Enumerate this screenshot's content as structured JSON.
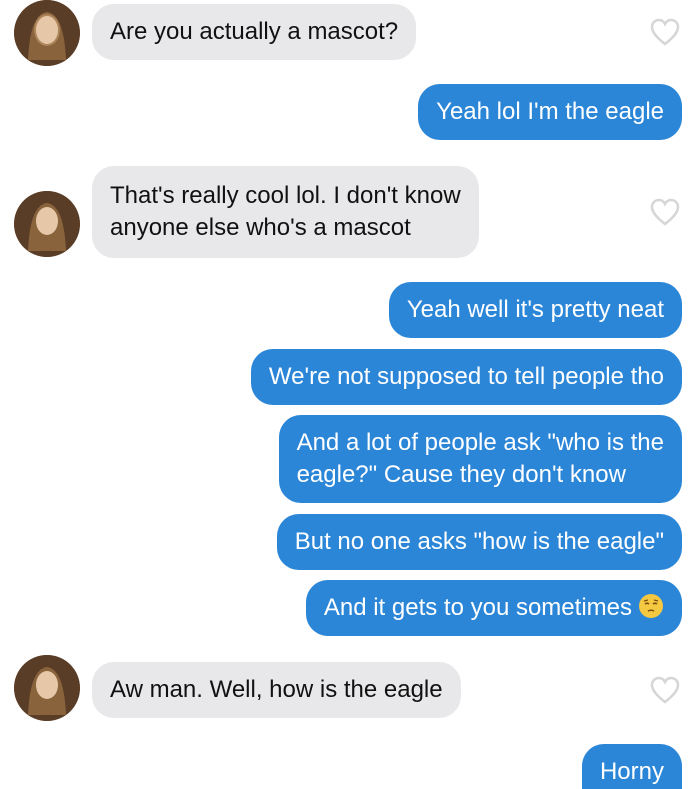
{
  "messages": [
    {
      "from": "them",
      "text": "Are you actually a mascot?"
    },
    {
      "from": "me",
      "text": "Yeah lol I'm the eagle"
    },
    {
      "from": "them",
      "lines": [
        "That's really cool lol. I don't know",
        "anyone else who's a mascot"
      ]
    },
    {
      "from": "me",
      "text": "Yeah well it's pretty neat"
    },
    {
      "from": "me",
      "text": "We're not supposed to tell people tho"
    },
    {
      "from": "me",
      "lines": [
        "And a lot of people ask \"who is the",
        "eagle?\" Cause they don't know"
      ]
    },
    {
      "from": "me",
      "text": "But no one asks \"how is the eagle\""
    },
    {
      "from": "me",
      "text": "And it gets to you sometimes",
      "emoji": "pensive-face-emoji"
    },
    {
      "from": "them",
      "text": "Aw man. Well, how is the eagle"
    },
    {
      "from": "me",
      "text": "Horny"
    }
  ],
  "colors": {
    "incoming_bubble": "#e8e8ea",
    "outgoing_bubble": "#2b86d8",
    "incoming_text": "#111111",
    "outgoing_text": "#ffffff",
    "heart_outline": "#d6d6d8"
  },
  "icons": {
    "like": "heart-outline-icon",
    "avatar": "profile-photo-avatar"
  }
}
